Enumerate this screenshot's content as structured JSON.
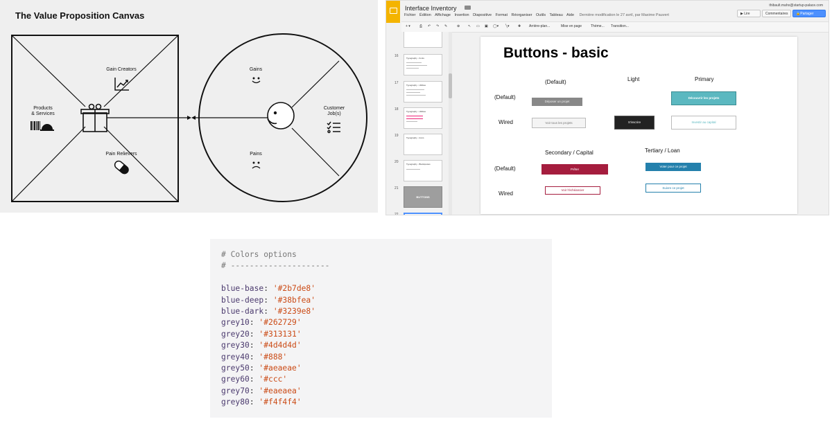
{
  "vpc": {
    "title": "The Value Proposition Canvas",
    "labels": {
      "gain_creators": "Gain Creators",
      "products_services": "Products\n& Services",
      "pain_relievers": "Pain Relievers",
      "gains": "Gains",
      "customer_jobs": "Customer\nJob(s)",
      "pains": "Pains"
    }
  },
  "slides": {
    "doc_title": "Interface Inventory",
    "menu": [
      "Fichier",
      "Édition",
      "Affichage",
      "Insertion",
      "Diapositive",
      "Format",
      "Réorganiser",
      "Outils",
      "Tableau",
      "Aide"
    ],
    "last_modified": "Dernière modification le 27 avril, par Maxime Pauvert",
    "account": "thibault.maho@startup-palace.com",
    "buttons": {
      "present": "Lire",
      "comments": "Commentaires",
      "share": "Partager"
    },
    "toolbar": {
      "background": "Arrière-plan...",
      "layout": "Mise en page",
      "theme": "Thème...",
      "transition": "Transition..."
    },
    "thumbnails": [
      {
        "num": "16",
        "title": "Typography - Fonts"
      },
      {
        "num": "17",
        "title": "Typography - Utilities"
      },
      {
        "num": "18",
        "title": "Typography - Utilities"
      },
      {
        "num": "19",
        "title": "Typography - Icons"
      },
      {
        "num": "20",
        "title": "Typography - Blockquotes"
      },
      {
        "num": "21",
        "title": "BUTTONS"
      },
      {
        "num": "22",
        "title": ""
      }
    ],
    "slide": {
      "title": "Buttons - basic",
      "col_default": "(Default)",
      "col_light": "Light",
      "col_primary": "Primary",
      "row_default": "(Default)",
      "row_wired": "Wired",
      "col_secondary": "Secondary / Capital",
      "col_tertiary": "Tertiary / Loan",
      "row_default_2": "(Default)",
      "row_wired_2": "Wired",
      "btn_deposer": "Déposer un projet",
      "btn_decouvrir": "Découvrir les projets",
      "btn_voir_tous": "Voir tous les projets",
      "btn_sinscrire": "S'inscrire",
      "btn_investir": "Investir au capital",
      "btn_preter": "Prêter",
      "btn_voter": "Voter pour ce projet",
      "btn_echeancier": "Voir l'échéancier",
      "btn_suivre": "Suivre ce projet"
    }
  },
  "code": {
    "comment_title": "# Colors options",
    "comment_rule": "# ---------------------",
    "colors": [
      {
        "key": "blue-base",
        "value": "'#2b7de8'"
      },
      {
        "key": "blue-deep",
        "value": "'#38bfea'"
      },
      {
        "key": "blue-dark",
        "value": "'#3239e8'"
      },
      {
        "key": "grey10",
        "value": "'#262729'"
      },
      {
        "key": "grey20",
        "value": "'#313131'"
      },
      {
        "key": "grey30",
        "value": "'#4d4d4d'"
      },
      {
        "key": "grey40",
        "value": "'#888'"
      },
      {
        "key": "grey50",
        "value": "'#aeaeae'"
      },
      {
        "key": "grey60",
        "value": "'#ccc'"
      },
      {
        "key": "grey70",
        "value": "'#eaeaea'"
      },
      {
        "key": "grey80",
        "value": "'#f4f4f4'"
      }
    ]
  },
  "theme": {
    "primary_teal": "#5bb8c0",
    "capital_red": "#a51d3e",
    "loan_blue": "#2480ac",
    "dark_button": "#222222",
    "google_yellow": "#f4b400",
    "share_blue": "#4d90fe"
  }
}
